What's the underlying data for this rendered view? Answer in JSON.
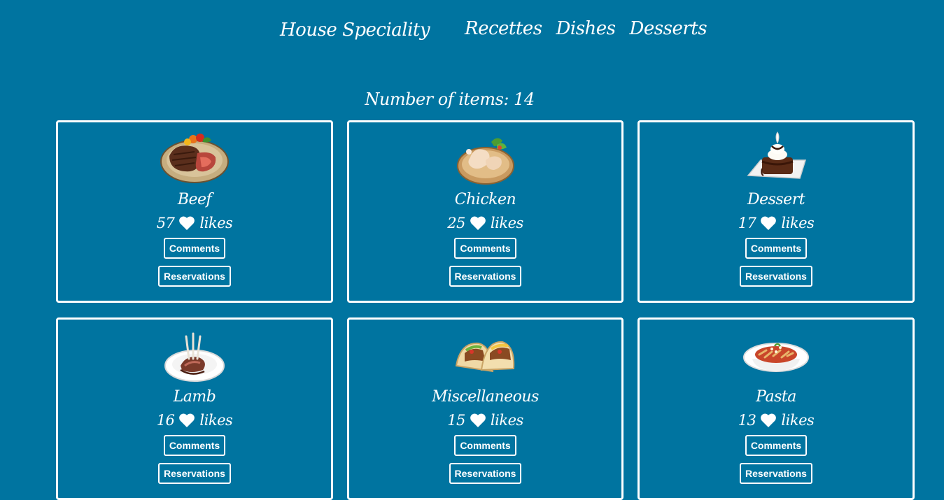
{
  "header": {
    "brand": "House Speciality",
    "nav": [
      "Recettes",
      "Dishes",
      "Desserts"
    ]
  },
  "counter": "Number of items: 14",
  "labels": {
    "comments": "Comments",
    "reservations": "Reservations",
    "likes": "likes"
  },
  "items": [
    {
      "name": "Beef",
      "likes": "57",
      "icon": "beef-steak-dish-image"
    },
    {
      "name": "Chicken",
      "likes": "25",
      "icon": "chicken-dish-image"
    },
    {
      "name": "Dessert",
      "likes": "17",
      "icon": "chocolate-dessert-image"
    },
    {
      "name": "Lamb",
      "likes": "16",
      "icon": "lamb-chops-dish-image"
    },
    {
      "name": "Miscellaneous",
      "likes": "15",
      "icon": "tacos-dish-image"
    },
    {
      "name": "Pasta",
      "likes": "13",
      "icon": "pasta-dish-image"
    }
  ],
  "colors": {
    "background": "#0074a0",
    "foreground": "#ffffff"
  }
}
